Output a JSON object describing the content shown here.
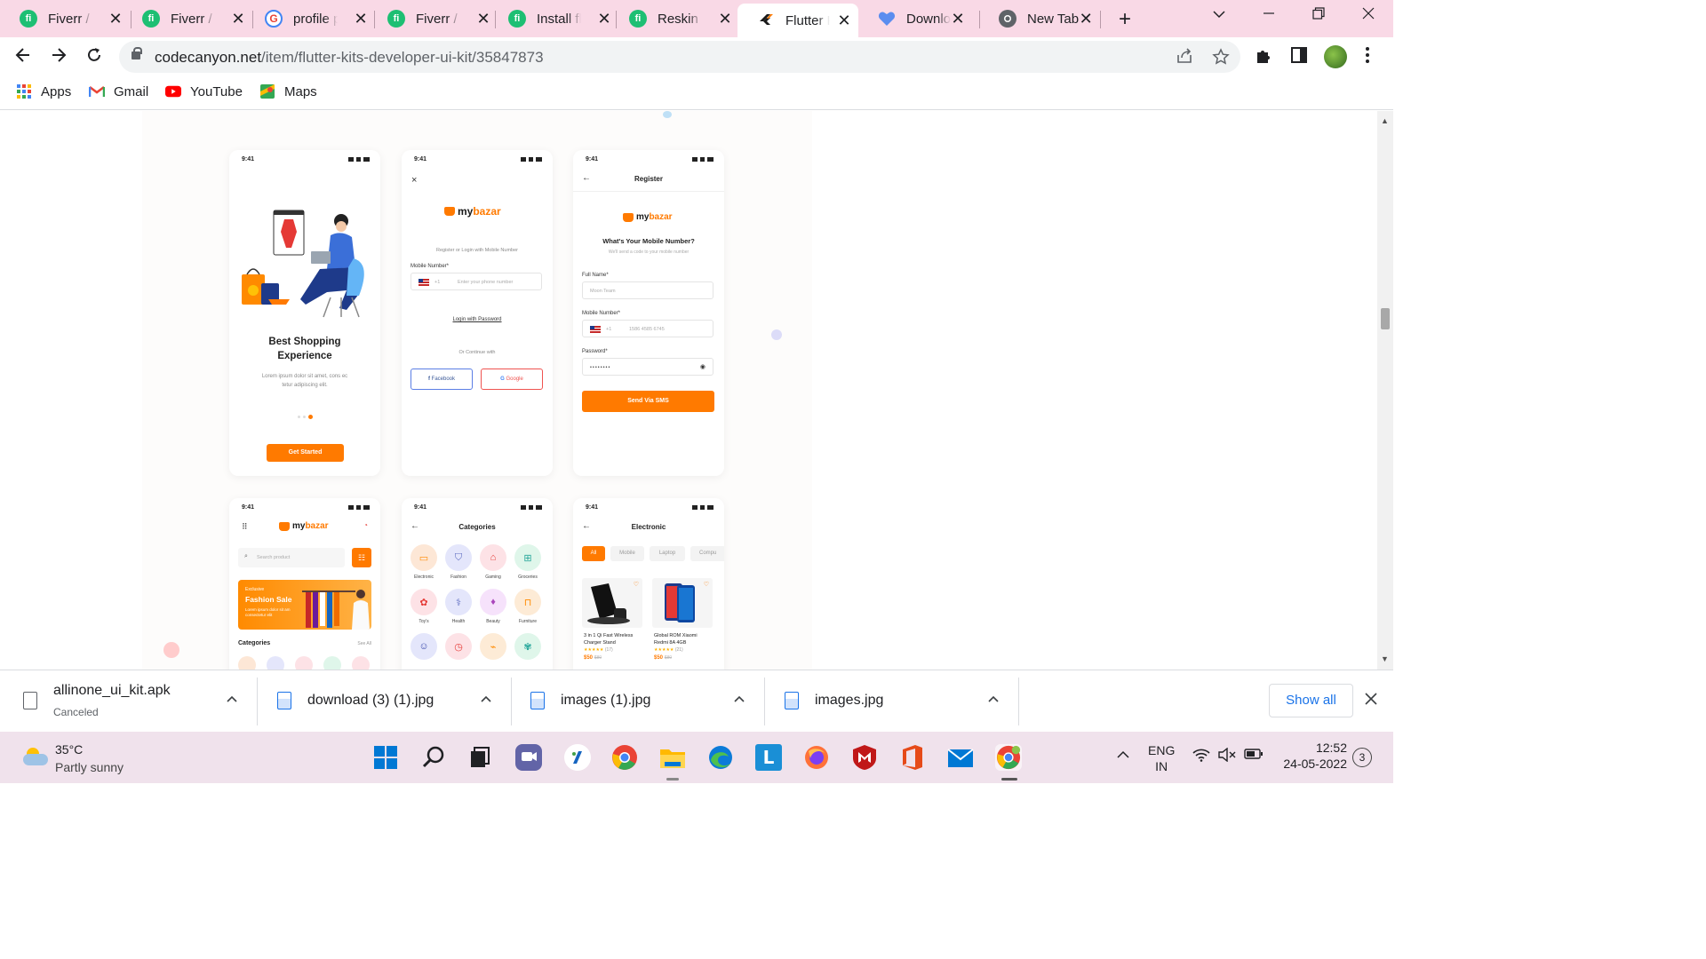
{
  "browser": {
    "tabs": [
      {
        "title": "Fiverr / s",
        "icon": "fiverr-icon"
      },
      {
        "title": "Fiverr / s",
        "icon": "fiverr-icon"
      },
      {
        "title": "profile pi",
        "icon": "google-icon"
      },
      {
        "title": "Fiverr / S",
        "icon": "fiverr-icon"
      },
      {
        "title": "Install flu",
        "icon": "fiverr-icon"
      },
      {
        "title": "Reskin ap",
        "icon": "fiverr-icon"
      },
      {
        "title": "Flutter Ki",
        "icon": "flutter-icon",
        "active": true
      },
      {
        "title": "Downloa",
        "icon": "heart-icon"
      },
      {
        "title": "New Tab",
        "icon": "chrome-icon"
      }
    ],
    "url_host": "codecanyon.net",
    "url_path": "/item/flutter-kits-developer-ui-kit/35847873",
    "bookmarks": [
      {
        "label": "Apps",
        "icon": "apps-grid-icon"
      },
      {
        "label": "Gmail",
        "icon": "gmail-icon"
      },
      {
        "label": "YouTube",
        "icon": "youtube-icon"
      },
      {
        "label": "Maps",
        "icon": "maps-icon"
      }
    ]
  },
  "screens": {
    "onboarding": {
      "time": "9:41",
      "title_line1": "Best Shopping",
      "title_line2": "Experience",
      "desc_line1": "Lorem ipsum dolor sit amet, cons ec",
      "desc_line2": "tetur adipiscing elit.",
      "button": "Get Started"
    },
    "login": {
      "time": "9:41",
      "close": "×",
      "brand_a": "my",
      "brand_b": "bazar",
      "subtitle": "Register or Login with Mobile Number",
      "mobile_label": "Mobile Number*",
      "code": "+1",
      "phone_placeholder": "Enter your phone number",
      "login_password": "Login with Password",
      "or_continue": "Or Continue with",
      "facebook": "Facebook",
      "google": "Google"
    },
    "register": {
      "time": "9:41",
      "title": "Register",
      "brand_a": "my",
      "brand_b": "bazar",
      "heading": "What's Your Mobile Number?",
      "subheading": "We'll send a code to your mobile number",
      "full_name_label": "Full Name*",
      "full_name_value": "Moon Team",
      "mobile_label": "Mobile Number*",
      "code": "+1",
      "mobile_value": "1586 4585 6745",
      "password_label": "Password*",
      "password_value": "••••••••",
      "button": "Send Via SMS"
    },
    "home": {
      "time": "9:41",
      "brand_a": "my",
      "brand_b": "bazar",
      "search_placeholder": "Search product",
      "banner_tag": "Exclusive",
      "banner_title": "Fashion Sale",
      "banner_desc": "Lorem ipsum dolor sit am consectetur elit",
      "categories": "Categories",
      "see_all": "See All"
    },
    "categories": {
      "time": "9:41",
      "title": "Categories",
      "items": [
        {
          "label": "Electronic",
          "color": "#fde7d6",
          "icon": "tv-icon"
        },
        {
          "label": "Fashion",
          "color": "#e4e6fb",
          "icon": "shirt-icon"
        },
        {
          "label": "Gaming",
          "color": "#fde2e6",
          "icon": "gamepad-icon"
        },
        {
          "label": "Groceries",
          "color": "#dff6ea",
          "icon": "basket-icon"
        },
        {
          "label": "Toy's",
          "color": "#fde2e6",
          "icon": "toy-icon"
        },
        {
          "label": "Health",
          "color": "#e4e6fb",
          "icon": "stethoscope-icon"
        },
        {
          "label": "Beauty",
          "color": "#f6e2fb",
          "icon": "lipstick-icon"
        },
        {
          "label": "Furniture",
          "color": "#fdebd6",
          "icon": "chair-icon"
        },
        {
          "label": "",
          "color": "#e4e6fb",
          "icon": "baby-icon"
        },
        {
          "label": "",
          "color": "#fde2e6",
          "icon": "watch-icon"
        },
        {
          "label": "",
          "color": "#fdebd6",
          "icon": "shoe-icon"
        },
        {
          "label": "",
          "color": "#dff6ea",
          "icon": "plant-icon"
        }
      ]
    },
    "electronic": {
      "time": "9:41",
      "title": "Electronic",
      "filters": [
        "All",
        "Mobile",
        "Laptop",
        "Compu"
      ],
      "products": [
        {
          "name_line1": "3 in 1 Qi Fast Wireless",
          "name_line2": "Charger Stand",
          "rating": "(17)",
          "price": "$50",
          "old_price": "$80"
        },
        {
          "name_line1": "Global ROM Xiaomi",
          "name_line2": "Redmi 8A 4GB",
          "rating": "(21)",
          "price": "$50",
          "old_price": "$80"
        }
      ]
    }
  },
  "downloads": [
    {
      "name": "allinone_ui_kit.apk",
      "status": "Canceled",
      "icon": "file-icon"
    },
    {
      "name": "download (3) (1).jpg",
      "status": "",
      "icon": "image-file-icon"
    },
    {
      "name": "images (1).jpg",
      "status": "",
      "icon": "image-file-icon"
    },
    {
      "name": "images.jpg",
      "status": "",
      "icon": "image-file-icon"
    }
  ],
  "downloads_show_all": "Show all",
  "taskbar": {
    "temperature": "35°C",
    "weather": "Partly sunny",
    "lang_line1": "ENG",
    "lang_line2": "IN",
    "time": "12:52",
    "date": "24-05-2022",
    "notifications": "3"
  },
  "colors": {
    "accent": "#ff7a00",
    "tabbar": "#f9d9e6",
    "taskbar": "#f0e2ec"
  }
}
